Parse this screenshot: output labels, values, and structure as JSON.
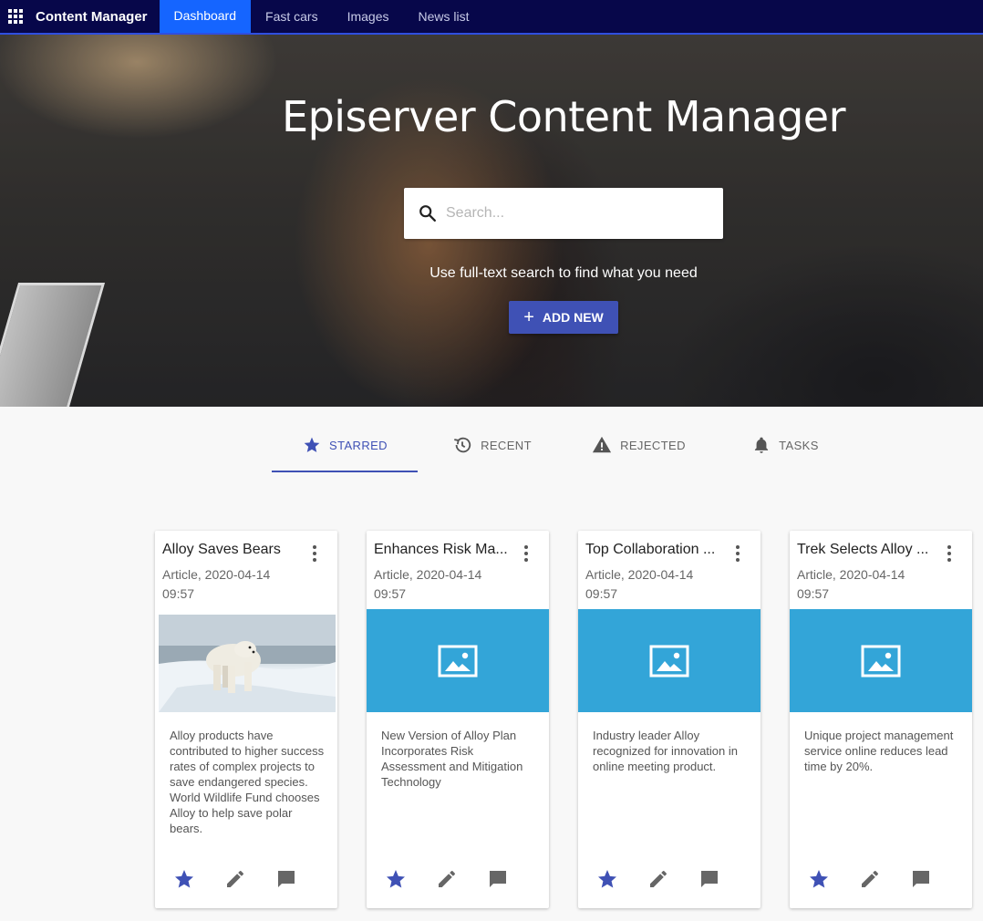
{
  "topbar": {
    "brand": "Content Manager",
    "tabs": [
      "Dashboard",
      "Fast cars",
      "Images",
      "News list"
    ]
  },
  "hero": {
    "title": "Episerver Content Manager",
    "search_placeholder": "Search...",
    "hint": "Use full-text search to find what you need",
    "add_label": "ADD NEW"
  },
  "content_tabs": [
    {
      "label": "STARRED",
      "icon": "star-icon"
    },
    {
      "label": "RECENT",
      "icon": "history-icon"
    },
    {
      "label": "REJECTED",
      "icon": "warning-icon"
    },
    {
      "label": "TASKS",
      "icon": "bell-icon"
    }
  ],
  "cards": [
    {
      "title": "Alloy Saves Bears",
      "meta_line1": "Article, 2020-04-14",
      "meta_line2": "09:57",
      "image": "polar-bear-photo",
      "description": "Alloy products have contributed to higher success rates of complex projects to save endangered species. World Wildlife Fund chooses Alloy to help save polar bears."
    },
    {
      "title": "Enhances Risk Ma...",
      "meta_line1": "Article, 2020-04-14",
      "meta_line2": "09:57",
      "image": "image-placeholder-icon",
      "description": "New Version of Alloy Plan Incorporates Risk Assessment and Mitigation Technology"
    },
    {
      "title": "Top Collaboration ...",
      "meta_line1": "Article, 2020-04-14",
      "meta_line2": "09:57",
      "image": "image-placeholder-icon",
      "description": "Industry leader Alloy recognized for innovation in online meeting product."
    },
    {
      "title": "Trek Selects Alloy ...",
      "meta_line1": "Article, 2020-04-14",
      "meta_line2": "09:57",
      "image": "image-placeholder-icon",
      "description": "Unique project management service online reduces lead time by 20%."
    }
  ],
  "colors": {
    "topbar": "#07074a",
    "active_nav": "#1565ff",
    "accent": "#3f51b5",
    "placeholder_blue": "#33a5d8"
  }
}
